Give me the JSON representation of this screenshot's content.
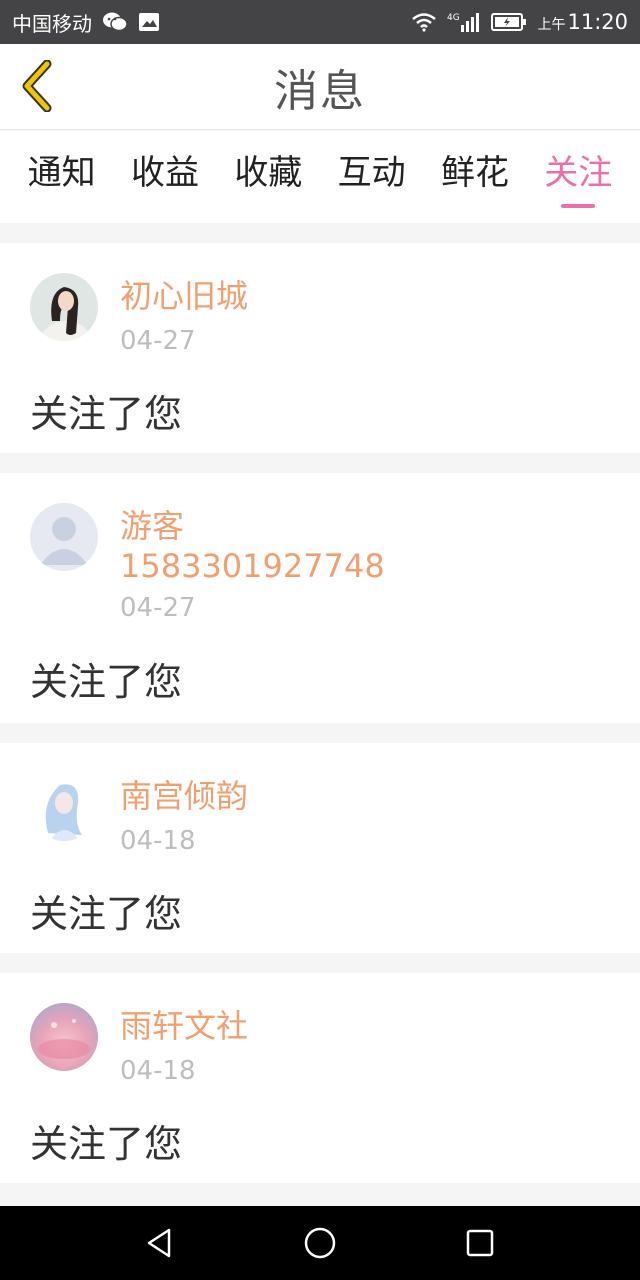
{
  "status": {
    "carrier": "中国移动",
    "network": "4G",
    "am_pm": "上午",
    "time": "11:20"
  },
  "header": {
    "title": "消息"
  },
  "tabs": [
    {
      "label": "通知",
      "active": false
    },
    {
      "label": "收益",
      "active": false
    },
    {
      "label": "收藏",
      "active": false
    },
    {
      "label": "互动",
      "active": false
    },
    {
      "label": "鲜花",
      "active": false
    },
    {
      "label": "关注",
      "active": true
    }
  ],
  "items": [
    {
      "name": "初心旧城",
      "date": "04-27",
      "message": "关注了您"
    },
    {
      "name": "游客\n1583301927748",
      "date": "04-27",
      "message": "关注了您"
    },
    {
      "name": "南宫倾韵",
      "date": "04-18",
      "message": "关注了您"
    },
    {
      "name": "雨轩文社",
      "date": "04-18",
      "message": "关注了您"
    }
  ],
  "colors": {
    "accent": "#ee6ea8",
    "username": "#f0a070",
    "back_arrow": "#f2c500"
  }
}
